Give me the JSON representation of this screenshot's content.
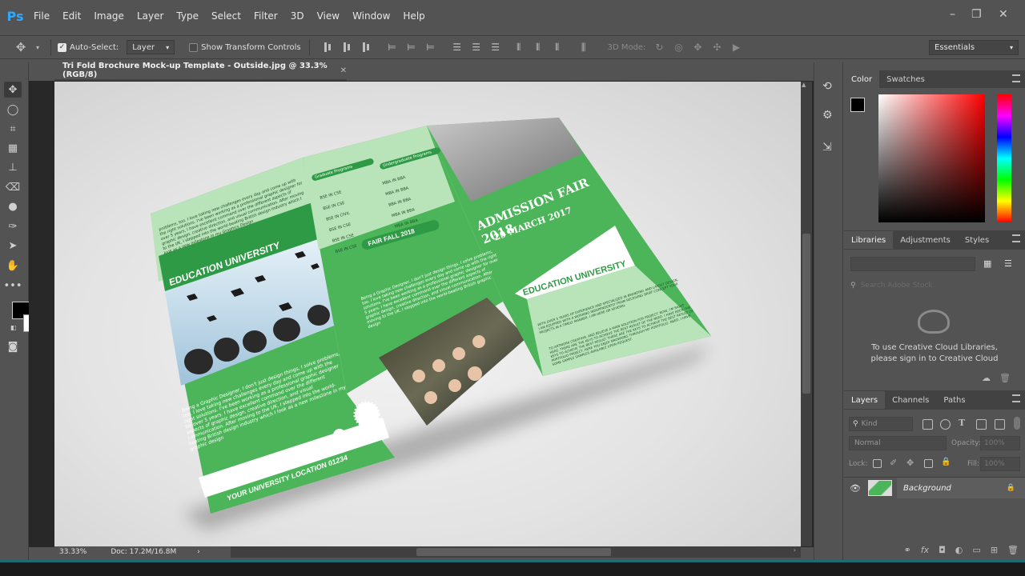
{
  "app": {
    "logo": "Ps"
  },
  "menu": [
    "File",
    "Edit",
    "Image",
    "Layer",
    "Type",
    "Select",
    "Filter",
    "3D",
    "View",
    "Window",
    "Help"
  ],
  "window_controls": {
    "minimize": "–",
    "restore": "❐",
    "close": "✕"
  },
  "options": {
    "auto_select_label": "Auto-Select:",
    "auto_select_checked": true,
    "auto_select_target": "Layer",
    "show_transform_label": "Show Transform Controls",
    "mode_3d_label": "3D Mode:",
    "workspace": "Essentials"
  },
  "document": {
    "tab_title": "Tri Fold Brochure Mock-up Template - Outside.jpg @ 33.3% (RGB/8)",
    "zoom": "33.33%",
    "doc_size": "Doc: 17.2M/16.8M"
  },
  "brochure": {
    "left_intro": "problems, too. I love taking new challenges every day and come up with the right solutions. I've been working as a professional graphic designer for over 5 years, I have excellent command over the different aspects of graphic design, creative direction, and visual communication. After moving to the UK, I stepped into the world-beating British design industry which I look as a new milestone in my Graphics Design",
    "left_title": "EDUCATION UNIVERSITY",
    "left_body": "Being a Graphic Designer, I don't just design things, I solve problems, too. I love taking new challenges every day and come up with the right solutions. I've been working as a professional graphic designer for over 5 years. I have excellent command over the different aspects of graphic design, creative direction, and visual communication. After moving to the UK, I stepped into the world-beating British design industry which I look as a new milestone in my graphic design",
    "location": "YOUR UNIVERSITY LOCATION 01234",
    "graduate_programs_title": "Graduate Programs",
    "undergraduate_programs_title": "Undergraduate Programs",
    "grad_programs": [
      "BSE IN CSE",
      "BSE IN CSE",
      "BSE IN CIVIL",
      "BSE IN CSE",
      "BSE IN CSE",
      "BSE IN CSE"
    ],
    "undergrad_programs": [
      "MBA IN BBA",
      "MBA IN BBA",
      "BBA IN BBA",
      "MBA IN BBA",
      "MBA IN BBA",
      "MBA IN BBA"
    ],
    "fair_fall": "FAIR FALL 2018",
    "mid_body": "Being a Graphic Designer, I don't just design things, I solve problems, too. I love taking new challenges every day and come up with the right solutions. I've been working as a professional graphic designer for over 5 years. I have excellent command over the different aspects of graphic design, creative direction, and visual communication. After moving to the UK, I stepped into the world-beating British graphic design",
    "admission_title": "ADMISSION FAIR 2018",
    "admission_date": "29 MARCH 2017",
    "right_title": "EDUCATION UNIVERSITY",
    "right_body1": "WITH OVER 5 YEARS OF EXPERIENCE AND SPECIALIZED IN BRANDING AND LAYOUT DESIGN, I AM EQUIPPED WITH A WORKING INDEPENDENTLY FROM RECEIVING BRIEF CONCEPT YOUR PROJECTS IN A TIMELY MANNER. I AM HERE OR SEVERAL",
    "right_body2": "TO ARTWORK CREATION. AND BELIEVE A MAIN SOLUTION FOR PROJECT. NOW, I'M RIGHT HERE. THERE ARE THE KEYS TO ACHIEVE THE BEST RESULT OF THE NEED. I HAVE BEEN THE KEYS TO ACHIEVE THE BEST RESULT. THERE ARE THE KEYS TO ACHIEVE THE BEST RESULT OF PORTFOLIO PROJECT. HERE YOU ENJOY BROWSING THROUGH MY PORTFOLIO. NEED. I HAVE SOME SAMPLE SAMPLES AVAILABLE UPON REQUEST."
  },
  "panels": {
    "color_tabs": [
      "Color",
      "Swatches"
    ],
    "libraries_tabs": [
      "Libraries",
      "Adjustments",
      "Styles"
    ],
    "search_placeholder": "Search Adobe Stock",
    "libraries_msg1": "To use Creative Cloud Libraries,",
    "libraries_msg2": "please sign in to Creative Cloud",
    "layers_tabs": [
      "Layers",
      "Channels",
      "Paths"
    ],
    "kind_label": "Kind",
    "blend_mode": "Normal",
    "opacity_label": "Opacity:",
    "opacity_value": "100%",
    "lock_label": "Lock:",
    "fill_label": "Fill:",
    "fill_value": "100%",
    "layer_name": "Background"
  },
  "colors": {
    "accent_green": "#4cb55a",
    "dark_green": "#2f9a45",
    "light_green": "#b9e3b9",
    "ps_blue": "#31a8ff",
    "panel_bg": "#535353",
    "foreground": "#000000",
    "background": "#ffffff"
  }
}
